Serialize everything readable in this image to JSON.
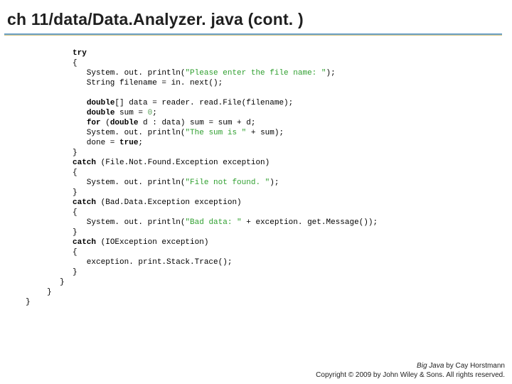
{
  "title": "ch 11/data/Data.Analyzer. java (cont. )",
  "code": {
    "l01": "try",
    "l02": "{",
    "l03a": "   System. out. println(",
    "l03b": "\"Please enter the file name: \"",
    "l03c": ");",
    "l04": "   String filename = in. next();",
    "l05": "",
    "l06a": "   ",
    "l06b": "double",
    "l06c": "[] data = reader. read.File(filename);",
    "l07a": "   ",
    "l07b": "double",
    "l07c": " sum = ",
    "l07d": "0",
    "l07e": ";",
    "l08a": "   ",
    "l08b": "for",
    "l08c": " (",
    "l08d": "double",
    "l08e": " d : data) sum = sum + d;",
    "l09a": "   System. out. println(",
    "l09b": "\"The sum is \"",
    "l09c": " + sum);",
    "l10a": "   done = ",
    "l10b": "true",
    "l10c": ";",
    "l11": "}",
    "l12a": "catch",
    "l12b": " (File.Not.Found.Exception exception)",
    "l13": "{",
    "l14a": "   System. out. println(",
    "l14b": "\"File not found. \"",
    "l14c": ");",
    "l15": "}",
    "l16a": "catch",
    "l16b": " (Bad.Data.Exception exception)",
    "l17": "{",
    "l18a": "   System. out. println(",
    "l18b": "\"Bad data: \"",
    "l18c": " + exception. get.Message());",
    "l19": "}",
    "l20a": "catch",
    "l20b": " (IOException exception)",
    "l21": "{",
    "l22": "   exception. print.Stack.Trace();",
    "l23": "}"
  },
  "closebraces": {
    "inner": "}",
    "mid": "}",
    "outer": "}"
  },
  "footer": {
    "book": "Big Java",
    "byline": " by Cay Horstmann",
    "copyright": "Copyright © 2009 by John Wiley & Sons.  All rights reserved."
  }
}
